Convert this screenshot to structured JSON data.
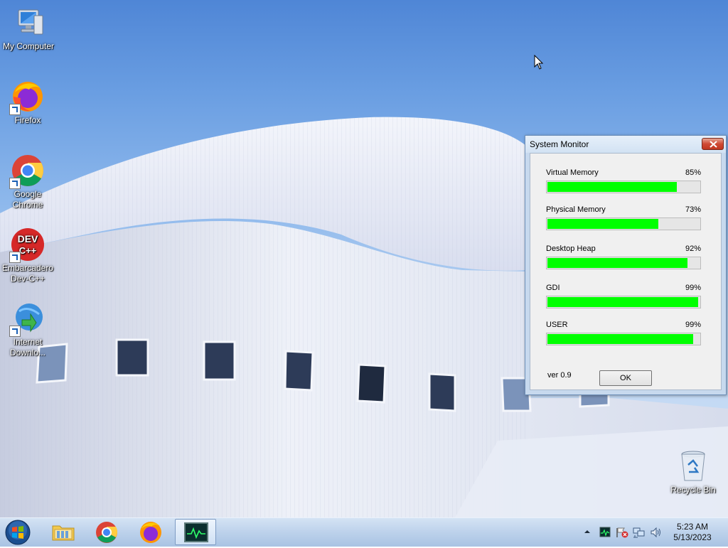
{
  "desktop": {
    "icons": [
      {
        "label": "My Computer",
        "icon": "computer-icon"
      },
      {
        "label": "Firefox",
        "icon": "firefox-icon"
      },
      {
        "label": "Google Chrome",
        "icon": "chrome-icon"
      },
      {
        "label": "Embarcadero Dev-C++",
        "icon": "devcpp-icon"
      },
      {
        "label": "Internet Downlo...",
        "icon": "idm-icon"
      },
      {
        "label": "Recycle Bin",
        "icon": "recycle-bin-icon"
      }
    ],
    "devcpp_icon_text": {
      "top": "DEV",
      "bottom": "C++"
    }
  },
  "window": {
    "title": "System Monitor",
    "meters": [
      {
        "label": "Virtual Memory",
        "percent_label": "85%",
        "fill": 0.85
      },
      {
        "label": "Physical Memory",
        "percent_label": "73%",
        "fill": 0.73
      },
      {
        "label": "Desktop Heap",
        "percent_label": "92%",
        "fill": 0.92
      },
      {
        "label": "GDI",
        "percent_label": "99%",
        "fill": 0.99
      },
      {
        "label": "USER",
        "percent_label": "99%",
        "fill": 0.96
      }
    ],
    "version": "ver 0.9",
    "ok_label": "OK",
    "bar_color": "#00ff00"
  },
  "taskbar": {
    "start_icon": "windows-start-icon",
    "pinned": [
      {
        "icon": "file-explorer-icon"
      },
      {
        "icon": "chrome-icon"
      },
      {
        "icon": "firefox-icon"
      },
      {
        "icon": "system-monitor-icon"
      }
    ],
    "tray": [
      "show-hidden-icons-chevron",
      "system-monitor-tray-icon",
      "action-center-flag-icon",
      "network-icon",
      "volume-icon"
    ],
    "clock": {
      "time": "5:23 AM",
      "date": "5/13/2023"
    }
  }
}
